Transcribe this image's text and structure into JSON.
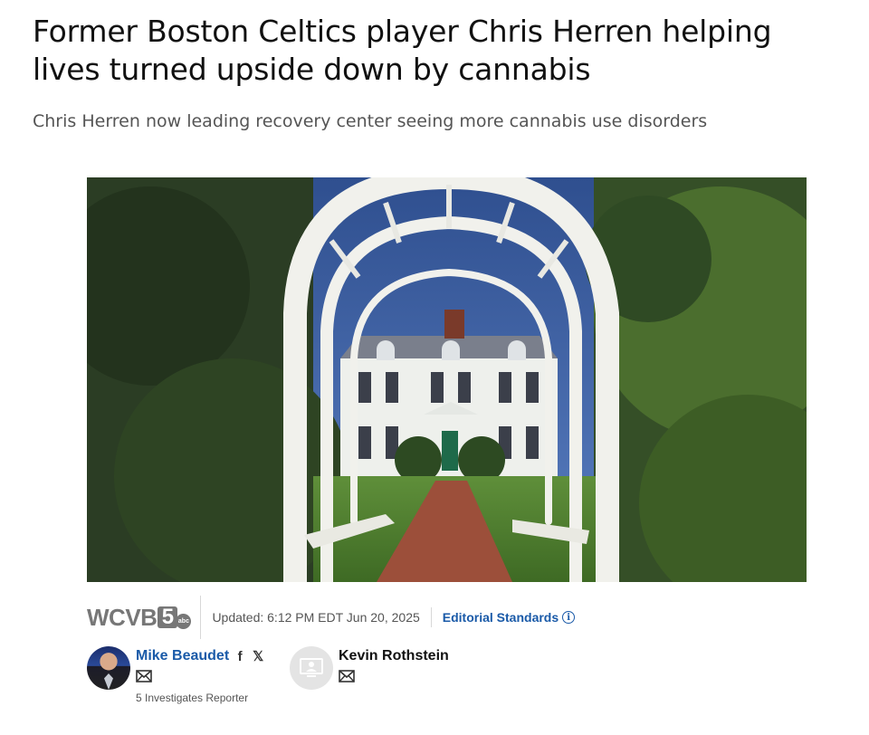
{
  "article": {
    "headline": "Former Boston Celtics player Chris Herren helping lives turned upside down by cannabis",
    "subheadline": "Chris Herren now leading recovery center seeing more cannabis use disorders"
  },
  "meta": {
    "logo_text": "WCVB",
    "logo_number": "5",
    "logo_network": "abc",
    "updated": "Updated: 6:12 PM EDT Jun 20, 2025",
    "editorial_standards": "Editorial Standards",
    "info_glyph": "i"
  },
  "authors": [
    {
      "name": "Mike Beaudet",
      "role": "5 Investigates Reporter",
      "social_facebook": "f",
      "social_x": "𝕏",
      "icons": [
        "facebook-icon",
        "x-icon",
        "mail-icon"
      ]
    },
    {
      "name": "Kevin Rothstein",
      "icons": [
        "mail-icon"
      ]
    }
  ],
  "colors": {
    "link": "#1a5aa8",
    "logo_gray": "#777777",
    "subhead_gray": "#555555"
  }
}
